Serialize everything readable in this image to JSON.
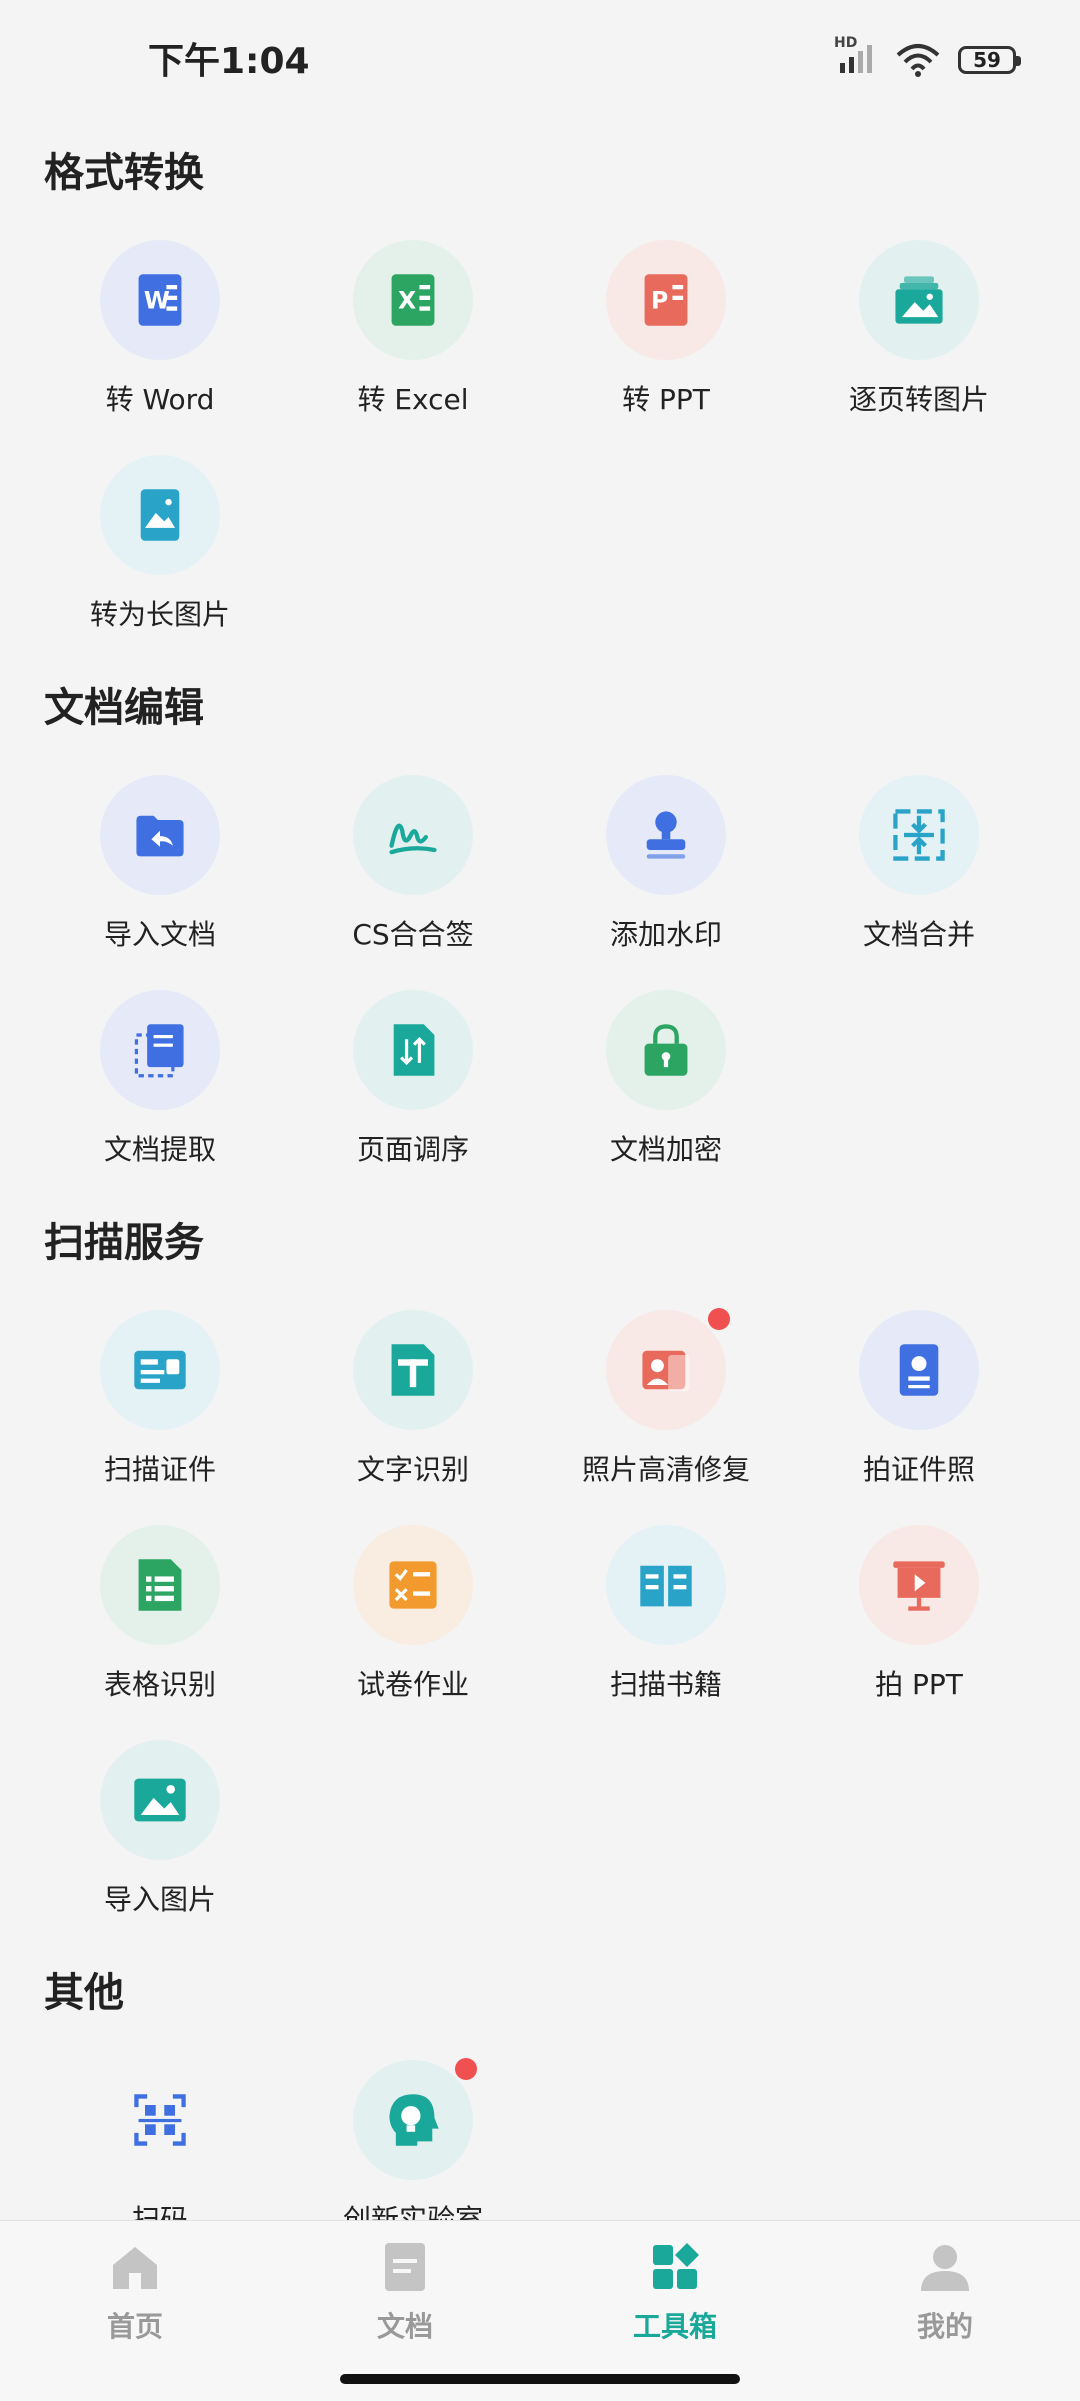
{
  "status_bar": {
    "time": "下午1:04",
    "network": "HD",
    "battery": "59"
  },
  "sections": [
    {
      "title": "格式转换",
      "tools": [
        {
          "label": "转 Word",
          "icon": "word-icon",
          "bg": "#e6eaf8",
          "color": "#3f6fe0"
        },
        {
          "label": "转 Excel",
          "icon": "excel-icon",
          "bg": "#e3f1ea",
          "color": "#2ca563"
        },
        {
          "label": "转 PPT",
          "icon": "ppt-icon",
          "bg": "#f8e8e6",
          "color": "#e86a5c"
        },
        {
          "label": "逐页转图片",
          "icon": "pages-to-image-icon",
          "bg": "#e2f1ef",
          "color": "#1aa89a"
        },
        {
          "label": "转为长图片",
          "icon": "long-image-icon",
          "bg": "#e4f2f5",
          "color": "#2aa3c9"
        }
      ]
    },
    {
      "title": "文档编辑",
      "tools": [
        {
          "label": "导入文档",
          "icon": "import-document-icon",
          "bg": "#e6eaf8",
          "color": "#3f6fe0"
        },
        {
          "label": "CS合合签",
          "icon": "signature-icon",
          "bg": "#e2f1ef",
          "color": "#1aa89a"
        },
        {
          "label": "添加水印",
          "icon": "stamp-icon",
          "bg": "#e6eaf8",
          "color": "#3f6fe0"
        },
        {
          "label": "文档合并",
          "icon": "merge-icon",
          "bg": "#e4f2f5",
          "color": "#2aa3c9"
        },
        {
          "label": "文档提取",
          "icon": "extract-icon",
          "bg": "#e6eaf8",
          "color": "#3f6fe0"
        },
        {
          "label": "页面调序",
          "icon": "reorder-icon",
          "bg": "#e2f1ef",
          "color": "#1aa89a"
        },
        {
          "label": "文档加密",
          "icon": "lock-icon",
          "bg": "#e3f1ea",
          "color": "#2ca563"
        }
      ]
    },
    {
      "title": "扫描服务",
      "tools": [
        {
          "label": "扫描证件",
          "icon": "id-card-icon",
          "bg": "#e4f2f5",
          "color": "#2aa3c9"
        },
        {
          "label": "文字识别",
          "icon": "text-recognition-icon",
          "bg": "#e2f1ef",
          "color": "#1aa89a"
        },
        {
          "label": "照片高清修复",
          "icon": "photo-restore-icon",
          "bg": "#f8e8e6",
          "color": "#e86a5c",
          "badge": true
        },
        {
          "label": "拍证件照",
          "icon": "id-photo-icon",
          "bg": "#e6eaf8",
          "color": "#3f6fe0"
        },
        {
          "label": "表格识别",
          "icon": "table-icon",
          "bg": "#e3f1ea",
          "color": "#2ca563"
        },
        {
          "label": "试卷作业",
          "icon": "homework-icon",
          "bg": "#f8ede0",
          "color": "#f29a2e"
        },
        {
          "label": "扫描书籍",
          "icon": "book-icon",
          "bg": "#e4f2f5",
          "color": "#2aa3c9"
        },
        {
          "label": "拍 PPT",
          "icon": "presentation-icon",
          "bg": "#f8e8e6",
          "color": "#e86a5c"
        },
        {
          "label": "导入图片",
          "icon": "import-image-icon",
          "bg": "#e2f1ef",
          "color": "#1aa89a"
        }
      ]
    },
    {
      "title": "其他",
      "tools": [
        {
          "label": "扫码",
          "icon": "qr-scan-icon",
          "bg": "#f4f4f4",
          "color": "#3f6fe0"
        },
        {
          "label": "创新实验室",
          "icon": "lab-icon",
          "bg": "#e2f1ef",
          "color": "#1aa89a",
          "badge": true
        }
      ]
    }
  ],
  "bottom_nav": [
    {
      "label": "首页",
      "icon": "home-icon"
    },
    {
      "label": "文档",
      "icon": "document-icon"
    },
    {
      "label": "工具箱",
      "icon": "toolbox-icon",
      "active": true
    },
    {
      "label": "我的",
      "icon": "profile-icon"
    }
  ]
}
